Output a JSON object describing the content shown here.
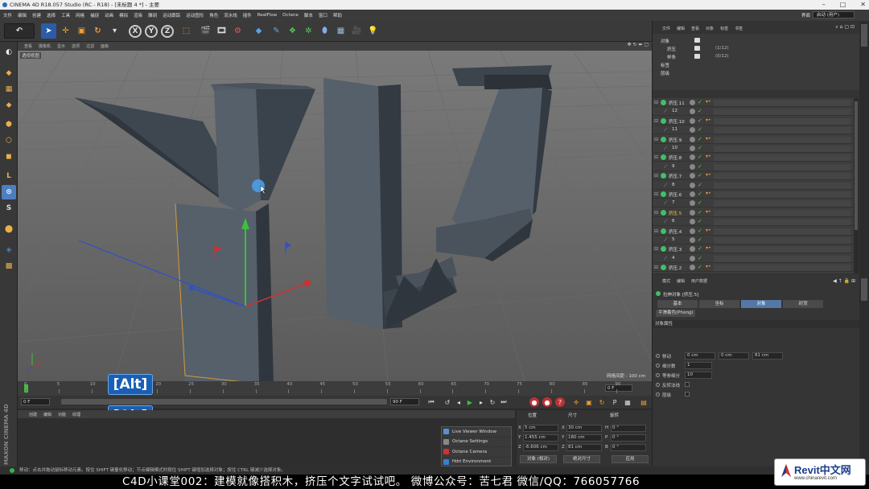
{
  "window": {
    "title": "CINEMA 4D R18.057 Studio (RC - R18) - [未标题 4 *] - 主要"
  },
  "menu": [
    "文件",
    "编辑",
    "创建",
    "选择",
    "工具",
    "网格",
    "捕捉",
    "动画",
    "模拟",
    "渲染",
    "雕刻",
    "运动跟踪",
    "运动图形",
    "角色",
    "流水线",
    "插件",
    "RealFlow",
    "Octane",
    "脚本",
    "窗口",
    "帮助"
  ],
  "layout": {
    "label": "界面",
    "value": "启动 (用户)"
  },
  "toolbar": {
    "axis_x": "X",
    "axis_y": "Y",
    "axis_z": "Z"
  },
  "viewport": {
    "menu": [
      "查看",
      "摄像机",
      "显示",
      "选项",
      "过滤",
      "面板"
    ],
    "label": "透视视图",
    "grid_scale": "网格间距 : 100 cm"
  },
  "timeline": {
    "ticks": [
      "0",
      "5",
      "10",
      "15",
      "20",
      "25",
      "30",
      "35",
      "40",
      "45",
      "50",
      "55",
      "60",
      "65",
      "70",
      "75",
      "80",
      "85",
      "90"
    ],
    "current_frame": "0 F",
    "start": "0 F",
    "end": "90 F",
    "frame_right": "0 F"
  },
  "overlays": {
    "alt_top": "[Alt]",
    "alt_bottom": "[Alt]"
  },
  "material": {
    "menu": [
      "创建",
      "编辑",
      "功能",
      "纹理"
    ],
    "brand": "MAXON CINEMA 4D"
  },
  "octane_menu": [
    "Live Viewer Window",
    "Octane Settings",
    "Octane Camera",
    "Hdri Environment"
  ],
  "coords": {
    "headers": [
      "位置",
      "尺寸",
      "旋转"
    ],
    "rows": [
      {
        "a": "X",
        "pos": "5 cm",
        "size_label": "X",
        "size": "30 cm",
        "rot_label": "H",
        "rot": "0 °"
      },
      {
        "a": "Y",
        "pos": "1.455 cm",
        "size_label": "Y",
        "size": "180 cm",
        "rot_label": "P",
        "rot": "0 °"
      },
      {
        "a": "Z",
        "pos": "-6.606 cm",
        "size_label": "Z",
        "size": "81 cm",
        "rot_label": "B",
        "rot": "0 °"
      }
    ],
    "mode": "对象 (相对)",
    "size_mode": "绝对尺寸",
    "apply": "应用"
  },
  "status": "移动：点击并拖动鼠标移动元素。按住 SHIFT 键量化移动；节点编辑模式时按住 SHIFT 键增加选择对象；按住 CTRL 键减少选择对象。",
  "subtitle": "C4D小课堂002：建模就像搭积木，挤压个文字试试吧。   微博公众号：苦七君   微信/QQ：766057766",
  "watermark": {
    "brand": "Revit中文网",
    "url": "www.chinarevit.com"
  },
  "object_manager": {
    "tabs": [
      "文件",
      "编辑",
      "查看",
      "对象",
      "标签",
      "书签"
    ],
    "top_rows": [
      {
        "name": "对象",
        "extra": ""
      },
      {
        "name": "挤压",
        "extra": "(1/12)"
      },
      {
        "name": "样条",
        "extra": "(0/12)"
      },
      {
        "name": "标签",
        "extra": ""
      },
      {
        "name": "层级",
        "extra": ""
      }
    ],
    "items": [
      {
        "name": "挤压.11",
        "child": false,
        "hl": false
      },
      {
        "name": "12",
        "child": true,
        "hl": false
      },
      {
        "name": "挤压.10",
        "child": false,
        "hl": false
      },
      {
        "name": "11",
        "child": true,
        "hl": false
      },
      {
        "name": "挤压.9",
        "child": false,
        "hl": false
      },
      {
        "name": "10",
        "child": true,
        "hl": false
      },
      {
        "name": "挤压.8",
        "child": false,
        "hl": false
      },
      {
        "name": "9",
        "child": true,
        "hl": false
      },
      {
        "name": "挤压.7",
        "child": false,
        "hl": false
      },
      {
        "name": "8",
        "child": true,
        "hl": false
      },
      {
        "name": "挤压.6",
        "child": false,
        "hl": false
      },
      {
        "name": "7",
        "child": true,
        "hl": false
      },
      {
        "name": "挤压.5",
        "child": false,
        "hl": true
      },
      {
        "name": "6",
        "child": true,
        "hl": false
      },
      {
        "name": "挤压.4",
        "child": false,
        "hl": false
      },
      {
        "name": "5",
        "child": true,
        "hl": false
      },
      {
        "name": "挤压.3",
        "child": false,
        "hl": false
      },
      {
        "name": "4",
        "child": true,
        "hl": false
      },
      {
        "name": "挤压.2",
        "child": false,
        "hl": false
      }
    ]
  },
  "attributes": {
    "tabs": [
      "模式",
      "编辑",
      "用户数据"
    ],
    "title": "拉伸对象 [挤压.5]",
    "sub_tabs": [
      "基本",
      "坐标",
      "对象",
      "封顶"
    ],
    "active_sub_tab": "对象",
    "phong": "平滑着色(Phong)",
    "section": "对象属性",
    "move_label": "移动",
    "move_x": "0 cm",
    "move_y": "0 cm",
    "move_z": "81 cm",
    "subdiv_label": "细分数",
    "subdiv": "1",
    "iso_label": "等参细分",
    "iso": "10",
    "flip_label": "反转法线",
    "hier_label": "层级"
  }
}
